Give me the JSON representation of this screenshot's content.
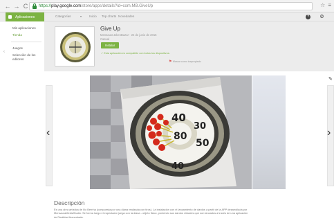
{
  "browser": {
    "back": "←",
    "forward": "→",
    "reload": "C",
    "url_scheme": "https://",
    "url_host": "play.google.com",
    "url_path": "/store/apps/details?id=com.MB.GiveUp",
    "star": "☆",
    "menu": "≡"
  },
  "topbar": {
    "apps_label": "Aplicaciones",
    "links": [
      "Categorías",
      "Inicio",
      "Top charts",
      "Novedades"
    ],
    "help": "?",
    "settings": "⚙"
  },
  "sidebar": {
    "items": [
      {
        "label": "Mis aplicaciones",
        "active": false
      },
      {
        "label": "Tienda",
        "active": true
      },
      {
        "label": "Juegos",
        "active": false
      },
      {
        "label": "Selección de los\neditores",
        "active": false
      }
    ],
    "collapse_icon": "‹"
  },
  "app": {
    "title": "Give Up",
    "developer": "Mensaura.tokenBazar · 24 de junio de 2015",
    "category": "Casual",
    "install_label": "Instalar",
    "compat_text": "Esta aplicación es compatible con todos tus dispositivos.",
    "flag_text": "Marcar como inapropiado"
  },
  "gallery": {
    "prev": "‹",
    "next": "›",
    "edit_icon": "✎",
    "target_numbers": [
      "40",
      "30",
      "80",
      "50",
      "40"
    ]
  },
  "description": {
    "title": "Descripción",
    "text": "Es una obra artística de Ilio Bernha (compuesta por una diana realizada con tiros). La instalación con el lanzamiento de dardos a partir de la APP desarrollada por MensauraMediaStudio. Se forma luego el espectador juega con la diana - objeto fisico, poniendo sus dardos virtuales que son lanzados a través de una aplicación de Realidad Aumentada."
  },
  "colors": {
    "accent": "#7cb342",
    "header_bg": "#ececec"
  }
}
